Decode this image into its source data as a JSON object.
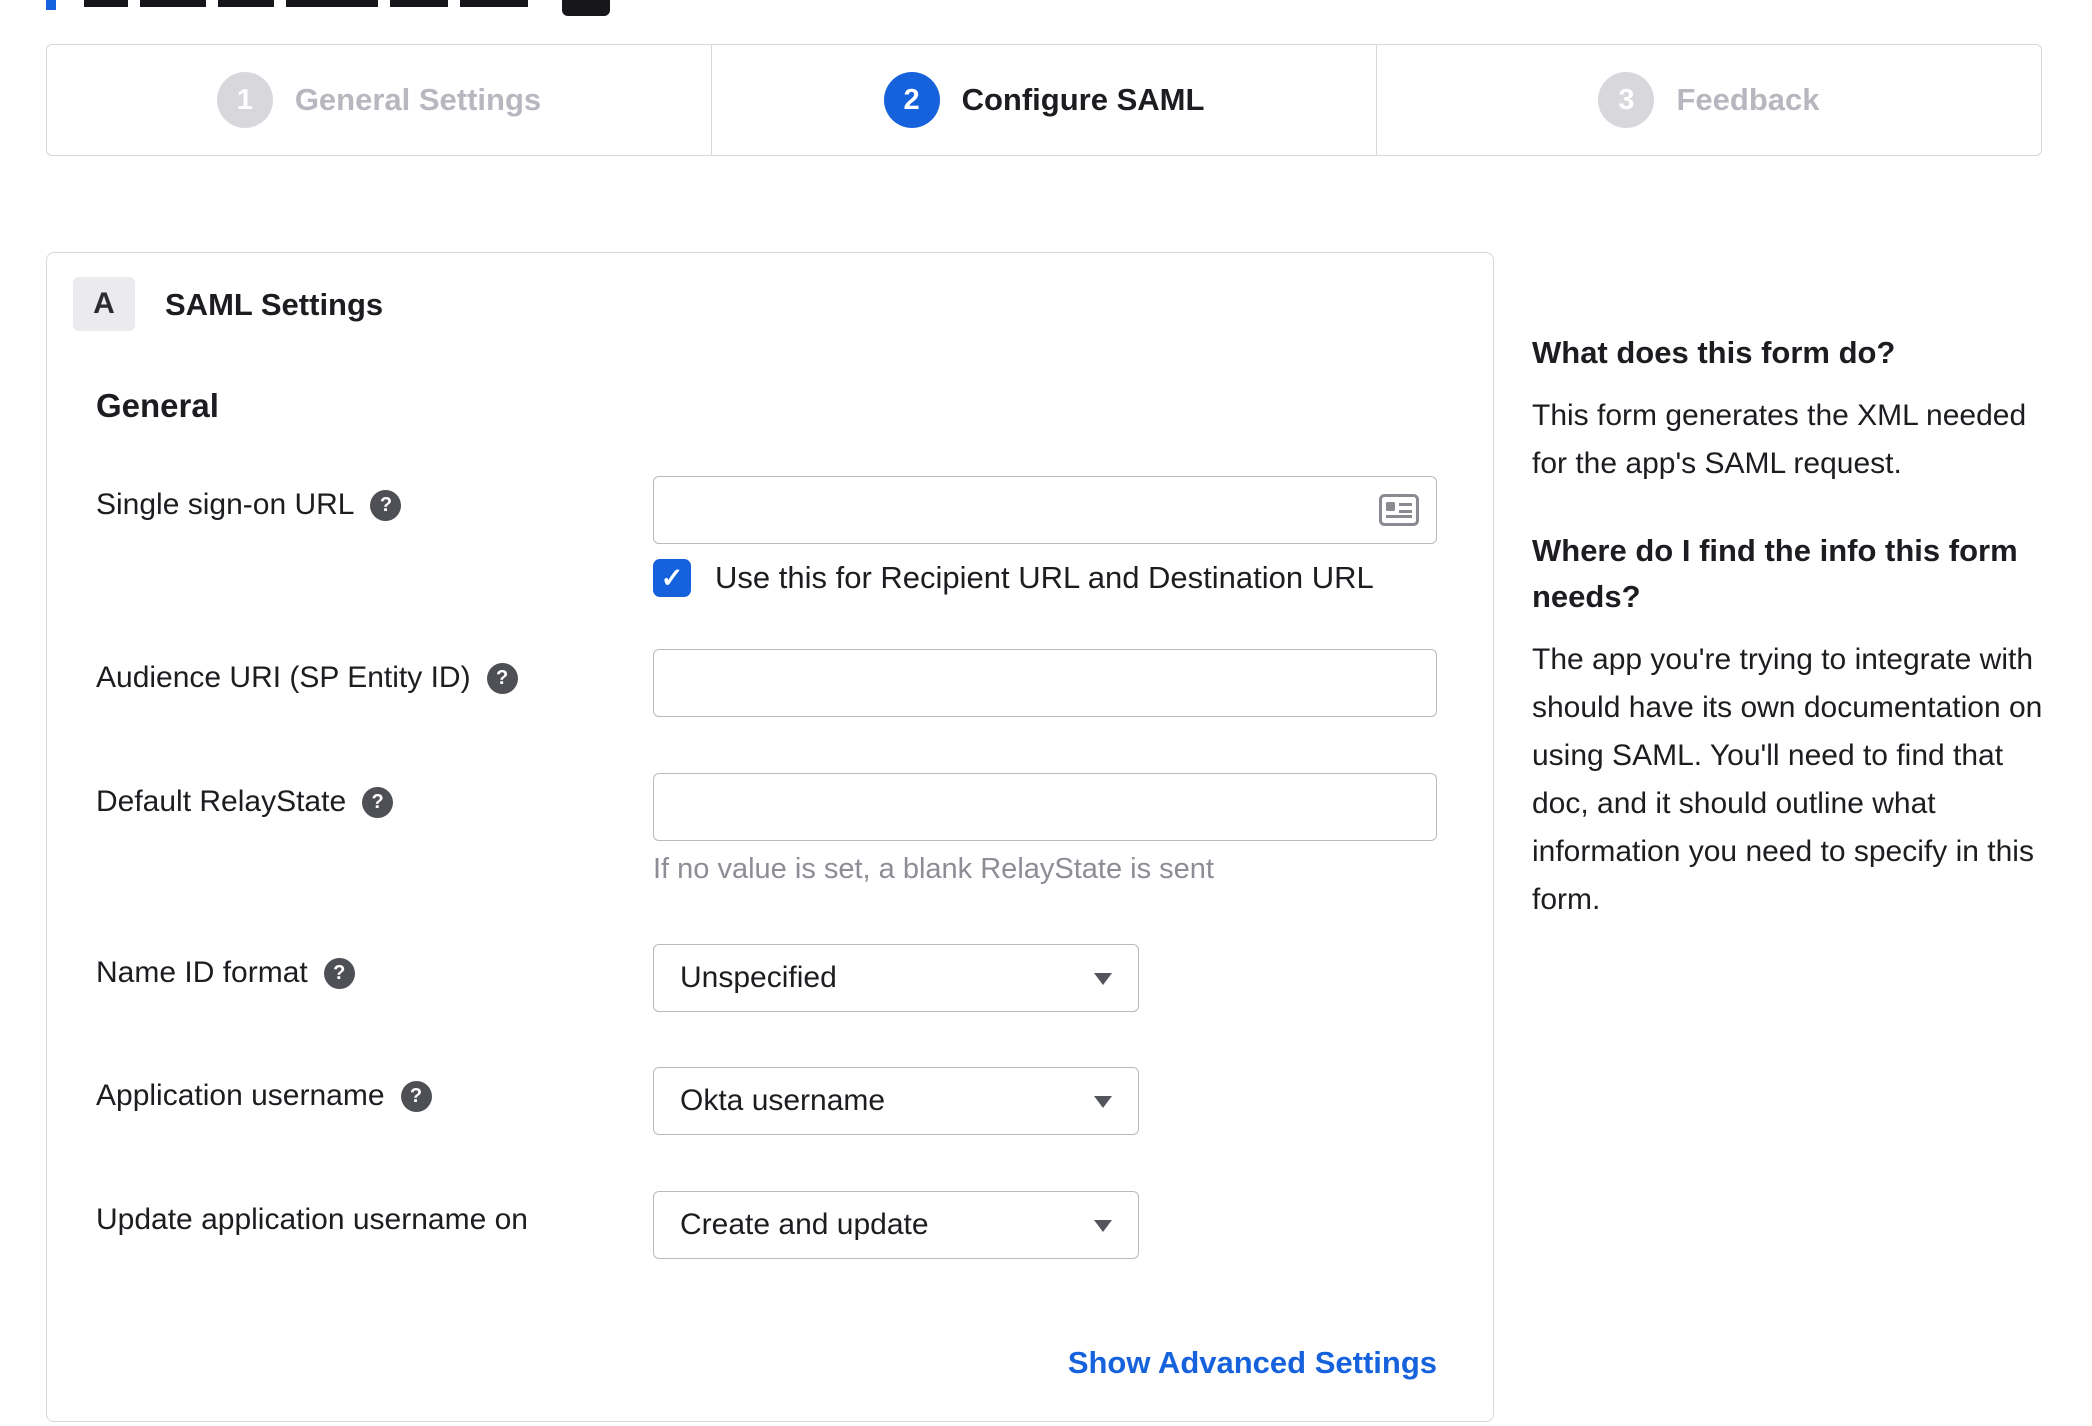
{
  "icons": {
    "help": "?",
    "check": "✓"
  },
  "colors": {
    "accent_blue": "#1662dd",
    "inactive_gray": "#d7d7dc",
    "link_blue": "#1662dd"
  },
  "stepper": {
    "steps": [
      {
        "number": "1",
        "label": "General Settings",
        "state": "inactive"
      },
      {
        "number": "2",
        "label": "Configure SAML",
        "state": "active"
      },
      {
        "number": "3",
        "label": "Feedback",
        "state": "inactive"
      }
    ]
  },
  "panel": {
    "badge": "A",
    "title": "SAML Settings",
    "section": "General",
    "sso": {
      "label": "Single sign-on URL",
      "value": "",
      "checkbox_label": "Use this for Recipient URL and Destination URL",
      "checkbox_checked": true
    },
    "audience": {
      "label": "Audience URI (SP Entity ID)",
      "value": ""
    },
    "relay": {
      "label": "Default RelayState",
      "value": "",
      "hint": "If no value is set, a blank RelayState is sent"
    },
    "name_id": {
      "label": "Name ID format",
      "value": "Unspecified"
    },
    "app_username": {
      "label": "Application username",
      "value": "Okta username"
    },
    "update_username": {
      "label": "Update application username on",
      "value": "Create and update"
    },
    "advanced_link": "Show Advanced Settings"
  },
  "sidebar": {
    "q1": "What does this form do?",
    "a1": "This form generates the XML needed\nfor the app's SAML request.",
    "q2": "Where do I find the info this form\nneeds?",
    "a2": "The app you're trying to integrate with\nshould have its own documentation on\nusing SAML. You'll need to find that\ndoc, and it should outline what\ninformation you need to specify in this\nform."
  }
}
